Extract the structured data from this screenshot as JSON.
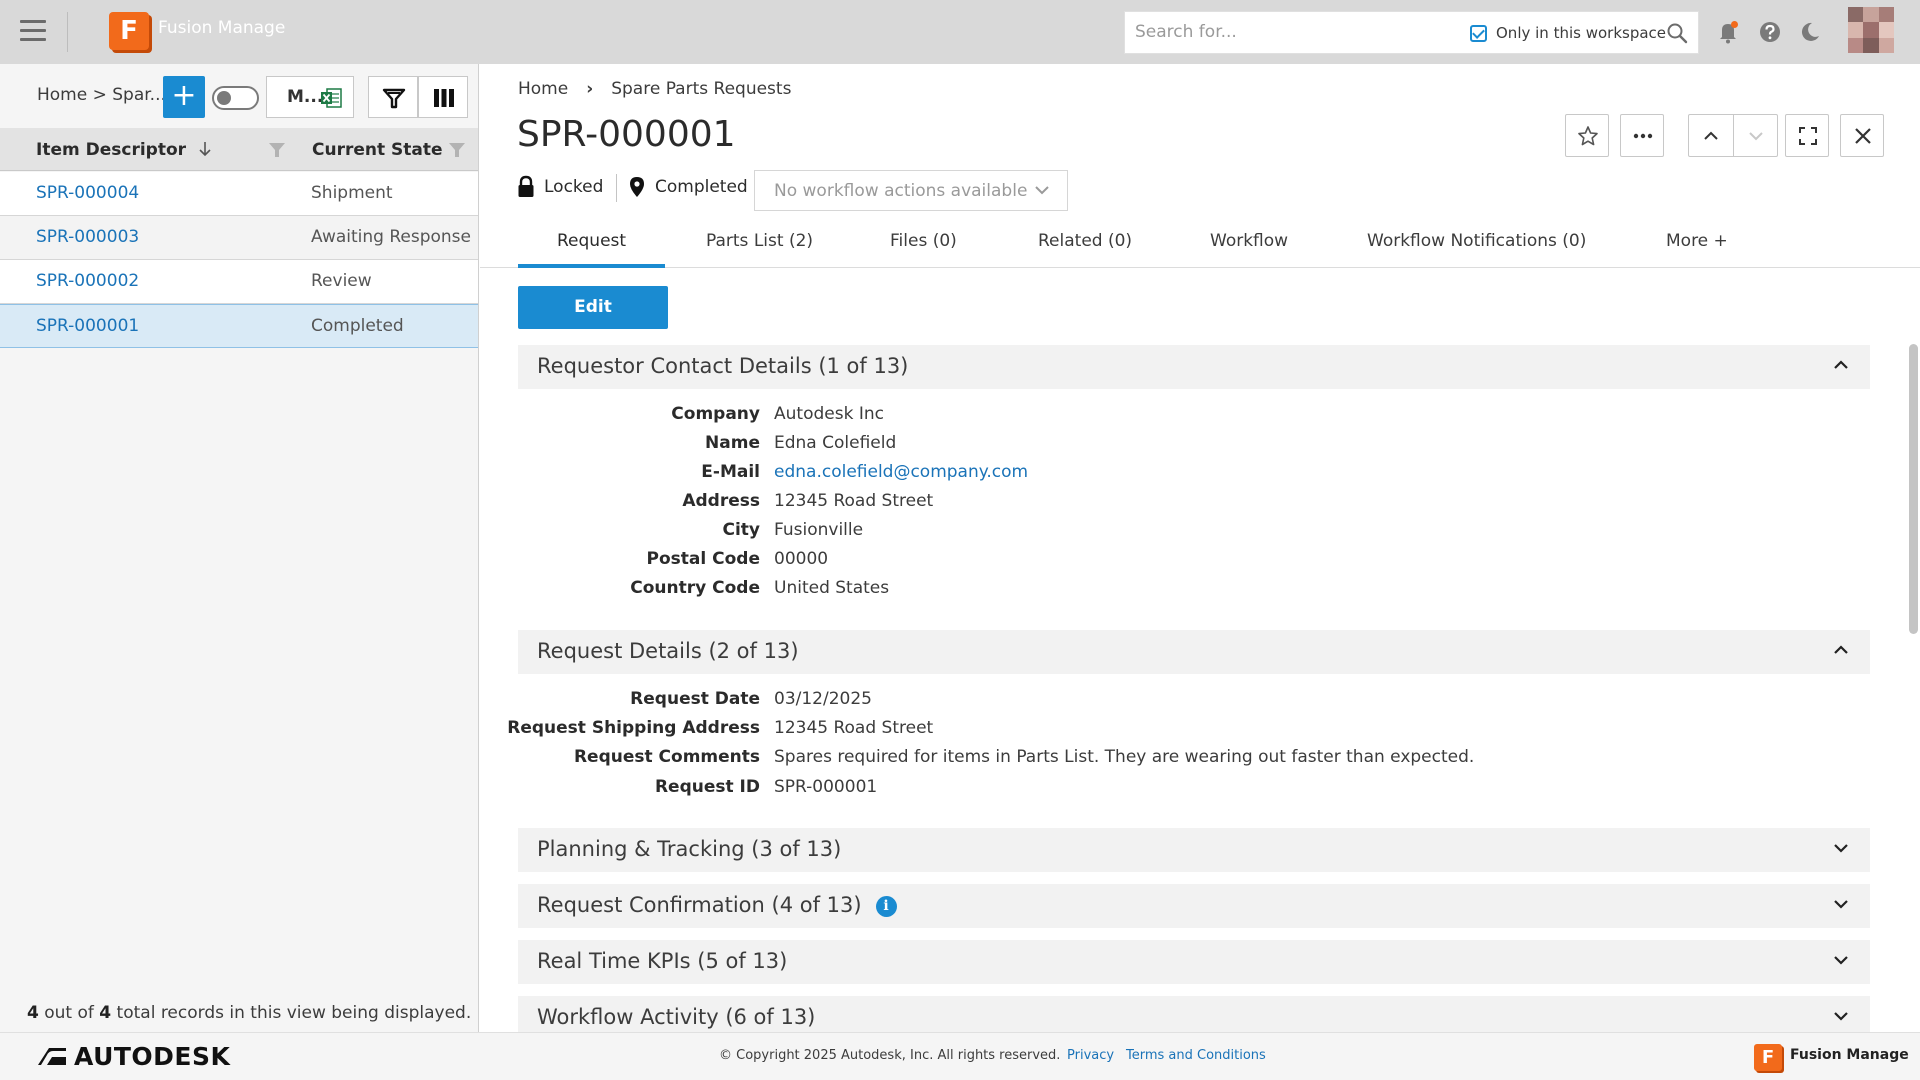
{
  "topbar": {
    "app_name": "Fusion Manage",
    "logo_letter": "F",
    "search_placeholder": "Search for...",
    "workspace_filter_label": "Only in this workspace",
    "workspace_filter_checked": true,
    "icons": [
      "menu-icon",
      "search-icon",
      "bell-icon",
      "help-icon",
      "moon-icon",
      "avatar"
    ],
    "colors": {
      "brand": "#f26a1b",
      "accent": "#1a8bd1"
    }
  },
  "left_panel": {
    "breadcrumb": "Home > Spar...",
    "add_label": "+",
    "export_label": "M...",
    "columns": [
      "Item Descriptor",
      "Current State"
    ],
    "rows": [
      {
        "id": "SPR-000004",
        "state": "Shipment"
      },
      {
        "id": "SPR-000003",
        "state": "Awaiting Response"
      },
      {
        "id": "SPR-000002",
        "state": "Review"
      },
      {
        "id": "SPR-000001",
        "state": "Completed",
        "selected": true
      }
    ],
    "footer": {
      "shown": "4",
      "middle": " out of ",
      "total": "4",
      "suffix": " total records in this view being displayed."
    }
  },
  "record": {
    "breadcrumb": {
      "home": "Home",
      "sep": "›",
      "workspace": "Spare Parts Requests"
    },
    "title": "SPR-000001",
    "lock_label": "Locked",
    "state_label": "Completed",
    "workflow_actions": "No workflow actions available",
    "tabs": [
      {
        "label": "Request",
        "active": true
      },
      {
        "label": "Parts List (2)"
      },
      {
        "label": "Files (0)"
      },
      {
        "label": "Related (0)"
      },
      {
        "label": "Workflow"
      },
      {
        "label": "Workflow Notifications (0)"
      },
      {
        "label": "More +"
      }
    ],
    "edit_label": "Edit",
    "sections": [
      {
        "title": "Requestor Contact Details (1 of 13)",
        "expanded": true,
        "fields": [
          {
            "label": "Company",
            "value": "Autodesk Inc"
          },
          {
            "label": "Name",
            "value": "Edna Colefield"
          },
          {
            "label": "E-Mail",
            "value": "edna.colefield@company.com",
            "link": true
          },
          {
            "label": "Address",
            "value": "12345 Road Street"
          },
          {
            "label": "City",
            "value": "Fusionville"
          },
          {
            "label": "Postal Code",
            "value": "00000"
          },
          {
            "label": "Country Code",
            "value": "United States"
          }
        ]
      },
      {
        "title": "Request Details (2 of 13)",
        "expanded": true,
        "fields": [
          {
            "label": "Request Date",
            "value": "03/12/2025"
          },
          {
            "label": "Request Shipping Address",
            "value": "12345 Road Street"
          },
          {
            "label": "Request Comments",
            "value": "Spares required for items in Parts List. They are wearing out faster than expected."
          },
          {
            "label": "Request ID",
            "value": "SPR-000001"
          }
        ]
      },
      {
        "title": "Planning & Tracking (3 of 13)",
        "expanded": false
      },
      {
        "title": "Request Confirmation (4 of 13)",
        "expanded": false,
        "info": "i"
      },
      {
        "title": "Real Time KPIs (5 of 13)",
        "expanded": false
      },
      {
        "title": "Workflow Activity (6 of 13)",
        "expanded": false
      }
    ]
  },
  "footer": {
    "brand": "AUTODESK",
    "copyright": "© Copyright 2025 Autodesk, Inc. All rights reserved.",
    "privacy": "Privacy",
    "terms": "Terms and Conditions",
    "product": "Fusion Manage",
    "product_letter": "F"
  }
}
